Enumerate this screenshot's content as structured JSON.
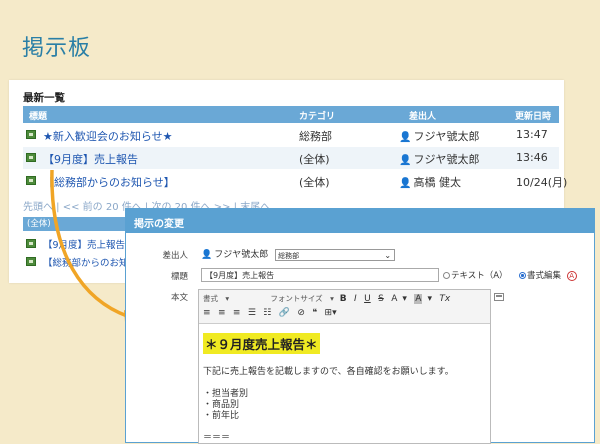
{
  "page": {
    "title": "掲示板"
  },
  "list": {
    "heading": "最新一覧",
    "columns": {
      "title": "標題",
      "category": "カテゴリ",
      "sender": "差出人",
      "updated": "更新日時"
    },
    "rows": [
      {
        "title": "★新入歓迎会のお知らせ★",
        "category": "総務部",
        "sender": "フジヤ號太郎",
        "date": "13:47"
      },
      {
        "title": "【9月度】売上報告",
        "category": "(全体)",
        "sender": "フジヤ號太郎",
        "date": "13:46"
      },
      {
        "title": "【総務部からのお知らせ】",
        "category": "(全体)",
        "sender": "高橋 健太",
        "date": "10/24(月)"
      }
    ],
    "pager": "先頭へ | << 前の 20 件へ | 次の 20 件へ >> | 末尾へ",
    "sub_header": "(全体)",
    "sub_rows": [
      {
        "title": "【9月度】売上報告"
      },
      {
        "title": "【総務部からのお知らせ】"
      }
    ]
  },
  "dialog": {
    "title": "掲示の変更",
    "sender_label": "差出人",
    "sender_name": "フジヤ號太郎",
    "sender_dept": "総務部",
    "title_label": "標題",
    "title_value": "【9月度】売上報告",
    "radio_text": "テキスト（A）",
    "radio_rich": "書式編集",
    "help_glyph": "A",
    "body_label": "本文",
    "toolbar": {
      "format": "書式",
      "font_size": "フォントサイズ",
      "bold": "B",
      "italic": "I",
      "underline": "U",
      "strike": "S",
      "text_color": "A",
      "bg_color": "A",
      "clear_format": "Tx"
    },
    "body": {
      "headline": "＊９月度売上報告＊",
      "lines": [
        "下記に売上報告を記載しますので、各自確認をお願いします。",
        "・担当者別",
        "・商品別",
        "・前年比",
        "＝＝＝"
      ]
    }
  },
  "colors": {
    "accent": "#2a7fa6",
    "header": "#6aa8d6",
    "dialog": "#5aa1d2",
    "arrow": "#f0a526",
    "highlight": "#f0ea22"
  }
}
